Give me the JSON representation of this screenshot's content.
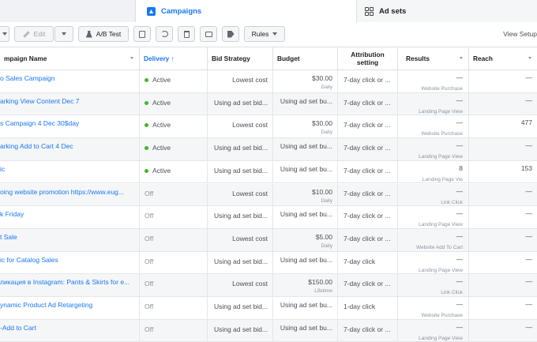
{
  "tabs": {
    "campaigns": "Campaigns",
    "adsets": "Ad sets"
  },
  "toolbar": {
    "edit": "Edit",
    "ab_test": "A/B Test",
    "rules": "Rules",
    "view_setup": "View Setup"
  },
  "columns": {
    "name": "mpaign Name",
    "delivery": "Delivery ↑",
    "bid_strategy": "Bid Strategy",
    "budget": "Budget",
    "attribution_line1": "Attribution",
    "attribution_line2": "setting",
    "results": "Results",
    "reach": "Reach"
  },
  "rows": [
    {
      "name": "o Sales Campaign",
      "delivery": "Active",
      "active": true,
      "bid": "Lowest cost",
      "budget": "$30.00",
      "budget_sub": "Daily",
      "attribution": "7-day click or ...",
      "results": "—",
      "results_sub": "Website Purchase",
      "reach": "—"
    },
    {
      "name": "arking View Content Dec 7",
      "delivery": "Active",
      "active": true,
      "bid": "Using ad set bid...",
      "budget": "Using ad set bu...",
      "budget_sub": "",
      "attribution": "7-day click or ...",
      "results": "—",
      "results_sub": "Landing Page View",
      "reach": "—"
    },
    {
      "name": "s Campaign 4 Dec 30$day",
      "delivery": "Active",
      "active": true,
      "bid": "Lowest cost",
      "budget": "$30.00",
      "budget_sub": "Daily",
      "attribution": "7-day click or ...",
      "results": "—",
      "results_sub": "Website Purchase",
      "reach": "477"
    },
    {
      "name": "arking Add to Cart 4 Dec",
      "delivery": "Active",
      "active": true,
      "bid": "Using ad set bid...",
      "budget": "Using ad set bu...",
      "budget_sub": "",
      "attribution": "7-day click or ...",
      "results": "—",
      "results_sub": "Landing Page View",
      "reach": "—"
    },
    {
      "name": "ic",
      "delivery": "Active",
      "active": true,
      "bid": "Using ad set bid...",
      "budget": "Using ad set bu...",
      "budget_sub": "",
      "attribution": "7-day click or ...",
      "results": "8",
      "results_sub": "Landing Page Vie",
      "reach": "153"
    },
    {
      "name": "oing website promotion https://www.eug...",
      "delivery": "Off",
      "active": false,
      "bid": "Lowest cost",
      "budget": "$10.00",
      "budget_sub": "Daily",
      "attribution": "7-day click or ...",
      "results": "—",
      "results_sub": "Link Click",
      "reach": "—"
    },
    {
      "name": "k Friday",
      "delivery": "Off",
      "active": false,
      "bid": "Using ad set bid...",
      "budget": "Using ad set bu...",
      "budget_sub": "",
      "attribution": "7-day click or ...",
      "results": "—",
      "results_sub": "Landing Page View",
      "reach": "—"
    },
    {
      "name": "t Sale",
      "delivery": "Off",
      "active": false,
      "bid": "Lowest cost",
      "budget": "$5.00",
      "budget_sub": "Daily",
      "attribution": "7-day click or ...",
      "results": "—",
      "results_sub": "Website Add To Cart",
      "reach": "—"
    },
    {
      "name": "ic for Catalog Sales",
      "delivery": "Off",
      "active": false,
      "bid": "Using ad set bid...",
      "budget": "Using ad set bu...",
      "budget_sub": "",
      "attribution": "7-day click",
      "results": "—",
      "results_sub": "Landing Page View",
      "reach": "—"
    },
    {
      "name": "ликация в Instagram: Pants & Skirts for e...",
      "delivery": "Off",
      "active": false,
      "bid": "Lowest cost",
      "budget": "$150.00",
      "budget_sub": "Lifetime",
      "attribution": "7-day click or ...",
      "results": "—",
      "results_sub": "Link Click",
      "reach": "—"
    },
    {
      "name": "ynamic Product Ad Retargeting",
      "delivery": "Off",
      "active": false,
      "bid": "Using ad set bid...",
      "budget": "Using ad set bu...",
      "budget_sub": "",
      "attribution": "1-day click",
      "results": "—",
      "results_sub": "Website Purchase",
      "reach": "—"
    },
    {
      "name": "-Add to Cart",
      "delivery": "Off",
      "active": false,
      "bid": "Using ad set bid...",
      "budget": "Using ad set bu...",
      "budget_sub": "",
      "attribution": "7-day click or ...",
      "results": "—",
      "results_sub": "Landing Page View",
      "reach": "—"
    }
  ]
}
